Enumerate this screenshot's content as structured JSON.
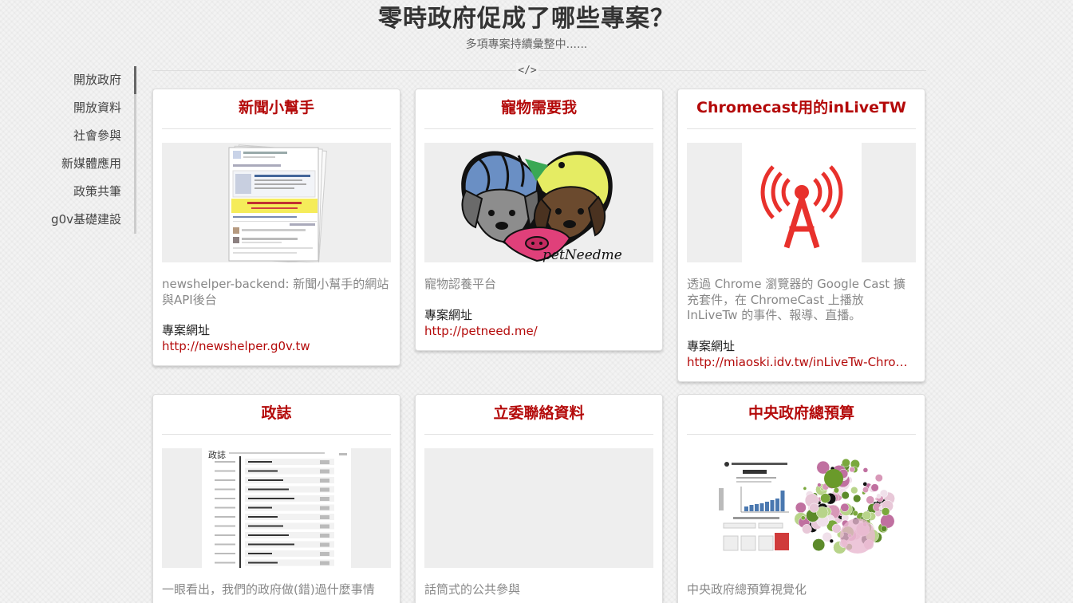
{
  "header": {
    "title": "零時政府促成了哪些專案？",
    "subtitle": "多項專案持續彙整中......",
    "divider_icon": "</>"
  },
  "sidebar": {
    "items": [
      {
        "label": "開放政府",
        "active": true
      },
      {
        "label": "開放資料"
      },
      {
        "label": "社會參與"
      },
      {
        "label": "新媒體應用"
      },
      {
        "label": "政策共筆"
      },
      {
        "label": "g0v基礎建設"
      }
    ]
  },
  "accent_color": "#b40a0a",
  "url_label": "專案網址",
  "cards": [
    {
      "title": "新聞小幫手",
      "description": "newshelper-backend: 新聞小幫手的網站與API後台",
      "url": "http://newshelper.g0v.tw",
      "image": "facebook-post-screenshot"
    },
    {
      "title": "寵物需要我",
      "description": "寵物認養平台",
      "url": "http://petneed.me/",
      "image": "petneedme-heart-logo",
      "logo_text": "petNeedme"
    },
    {
      "title": "Chromecast用的inLiveTW",
      "description": "透過 Chrome 瀏覽器的 Google Cast 擴充套件，在 ChromeCast 上播放 InLiveTw 的事件、報導、直播。",
      "url": "http://miaoski.idv.tw/inLiveTw-Chromecast/",
      "image": "broadcast-antenna-icon"
    },
    {
      "title": "政誌",
      "description": "一眼看出，我們的政府做(錯)過什麼事情",
      "image": "timeline-screenshot"
    },
    {
      "title": "立委聯絡資料",
      "description": "話筒式的公共參與",
      "image": "empty"
    },
    {
      "title": "中央政府總預算",
      "description": "中央政府總預算視覺化",
      "image": "budget-bubble-chart"
    }
  ]
}
